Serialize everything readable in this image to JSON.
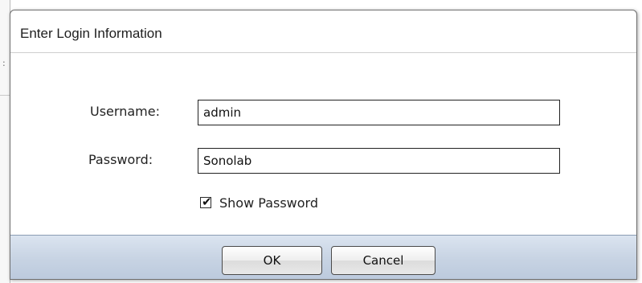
{
  "dialog": {
    "title": "Enter Login Information"
  },
  "form": {
    "username_label": "Username:",
    "username_value": "admin",
    "password_label": "Password:",
    "password_value": "Sonolab",
    "show_password_label": "Show Password",
    "show_password_checked": true
  },
  "buttons": {
    "ok_label": "OK",
    "cancel_label": "Cancel"
  },
  "icons": {
    "checkbox_tick": "check-icon"
  },
  "colors": {
    "button_bar_top": "#dbe4f0",
    "button_bar_bottom": "#bccadd",
    "border": "#6f6f6f"
  }
}
